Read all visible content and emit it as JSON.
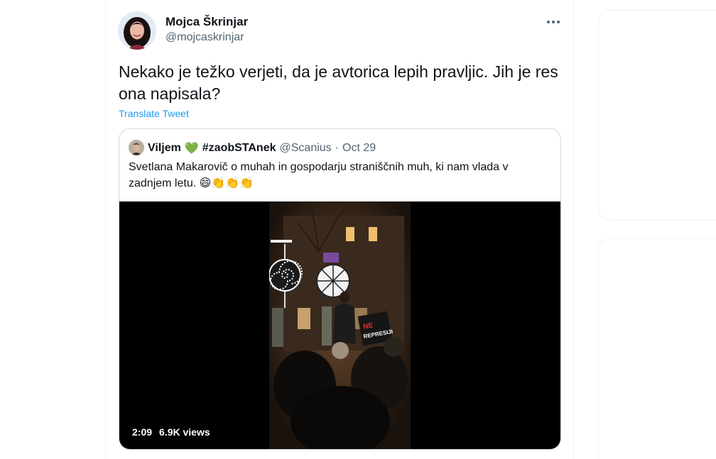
{
  "tweet": {
    "author_name": "Mojca Škrinjar",
    "author_handle": "@mojcaskrinjar",
    "text": "Nekako je težko verjeti, da je avtorica lepih pravljic. Jih je res ona napisala?",
    "translate_label": "Translate Tweet",
    "more_icon": "more-horizontal-icon"
  },
  "quote": {
    "author_name": "Viljem",
    "heart_emoji": "💚",
    "hashtag": "#zaobSTAnek",
    "handle": "@Scanius",
    "separator": "·",
    "date": "Oct 29",
    "text": "Svetlana Makarovič o muhah in gospodarju straniščnih muh, ki nam vlada v zadnjem letu. 😄👏👏👏",
    "media": {
      "duration": "2:09",
      "views": "6.9K views",
      "sign_text_1": "NE",
      "sign_text_2": "REPRESIJI"
    }
  },
  "colors": {
    "text_primary": "#0f1419",
    "text_secondary": "#536471",
    "link": "#1d9bf0",
    "border": "#cfd9de"
  }
}
